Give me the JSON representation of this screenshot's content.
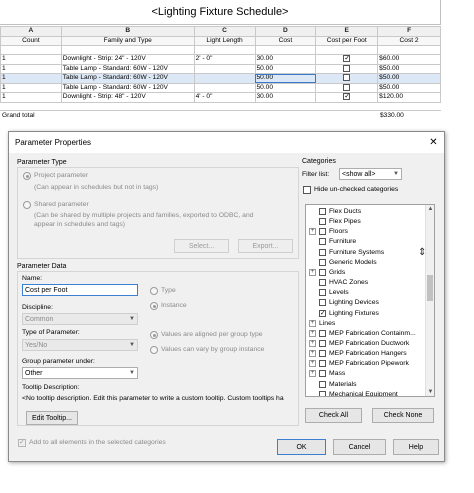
{
  "schedule": {
    "title": "<Lighting Fixture Schedule>",
    "letters": [
      "A",
      "B",
      "C",
      "D",
      "E",
      "F"
    ],
    "headers": [
      "Count",
      "Family and Type",
      "Light Length",
      "Cost",
      "Cost per Foot",
      "Cost 2"
    ],
    "rows": [
      {
        "count": "1",
        "family": "Downlight - Strip: 24\" - 120V",
        "length": "2' - 0\"",
        "cost": "30.00",
        "cpf": true,
        "cost2": "$60.00"
      },
      {
        "count": "1",
        "family": "Table Lamp - Standard: 60W - 120V",
        "length": "",
        "cost": "50.00",
        "cpf": false,
        "cost2": "$50.00"
      },
      {
        "count": "1",
        "family": "Table Lamp - Standard: 60W - 120V",
        "length": "",
        "cost": "50.00",
        "cpf": false,
        "cost2": "$50.00"
      },
      {
        "count": "1",
        "family": "Table Lamp - Standard: 60W - 120V",
        "length": "",
        "cost": "50.00",
        "cpf": false,
        "cost2": "$50.00"
      },
      {
        "count": "1",
        "family": "Downlight - Strip: 48\" - 120V",
        "length": "4' - 0\"",
        "cost": "30.00",
        "cpf": true,
        "cost2": "$120.00"
      }
    ],
    "grand_total_label": "Grand total",
    "grand_total_value": "$330.00"
  },
  "dialog": {
    "title": "Parameter Properties",
    "parameter_type": {
      "heading": "Parameter Type",
      "project_label": "Project parameter",
      "project_desc": "(Can appear in schedules but not in tags)",
      "shared_label": "Shared parameter",
      "shared_desc_1": "(Can be shared by multiple projects and families, exported to ODBC, and",
      "shared_desc_2": "appear in schedules and tags)",
      "select_button": "Select...",
      "export_button": "Export..."
    },
    "parameter_data": {
      "heading": "Parameter Data",
      "name_label": "Name:",
      "name_value": "Cost per Foot",
      "type_label": "Type",
      "instance_label": "Instance",
      "discipline_label": "Discipline:",
      "discipline_value": "Common",
      "type_of_param_label": "Type of Parameter:",
      "type_of_param_value": "Yes/No",
      "aligned_label": "Values are aligned per group type",
      "vary_label": "Values can vary by group instance",
      "group_under_label": "Group parameter under:",
      "group_under_value": "Other",
      "tooltip_label": "Tooltip Description:",
      "tooltip_text": "<No tooltip description. Edit this parameter to write a custom tooltip. Custom tooltips ha",
      "edit_tooltip_button": "Edit Tooltip..."
    },
    "categories": {
      "heading": "Categories",
      "filter_label": "Filter list:",
      "filter_value": "<show all>",
      "hide_unchecked_label": "Hide un-checked categories",
      "items": [
        {
          "name": "Flex Ducts",
          "checked": false,
          "expandable": false,
          "top": false
        },
        {
          "name": "Flex Pipes",
          "checked": false,
          "expandable": false,
          "top": false
        },
        {
          "name": "Floors",
          "checked": false,
          "expandable": true,
          "top": false
        },
        {
          "name": "Furniture",
          "checked": false,
          "expandable": false,
          "top": false
        },
        {
          "name": "Furniture Systems",
          "checked": false,
          "expandable": false,
          "top": false
        },
        {
          "name": "Generic Models",
          "checked": false,
          "expandable": false,
          "top": false
        },
        {
          "name": "Grids",
          "checked": false,
          "expandable": true,
          "top": false
        },
        {
          "name": "HVAC Zones",
          "checked": false,
          "expandable": false,
          "top": false
        },
        {
          "name": "Levels",
          "checked": false,
          "expandable": false,
          "top": false
        },
        {
          "name": "Lighting Devices",
          "checked": false,
          "expandable": false,
          "top": false
        },
        {
          "name": "Lighting Fixtures",
          "checked": true,
          "expandable": false,
          "top": false
        },
        {
          "name": "Lines",
          "checked": false,
          "expandable": true,
          "top": true
        },
        {
          "name": "MEP Fabrication Containm...",
          "checked": false,
          "expandable": true,
          "top": false
        },
        {
          "name": "MEP Fabrication Ductwork",
          "checked": false,
          "expandable": true,
          "top": false
        },
        {
          "name": "MEP Fabrication Hangers",
          "checked": false,
          "expandable": true,
          "top": false
        },
        {
          "name": "MEP Fabrication Pipework",
          "checked": false,
          "expandable": true,
          "top": false
        },
        {
          "name": "Mass",
          "checked": false,
          "expandable": true,
          "top": false
        },
        {
          "name": "Materials",
          "checked": false,
          "expandable": false,
          "top": false
        },
        {
          "name": "Mechanical Equipment",
          "checked": false,
          "expandable": false,
          "top": false
        }
      ],
      "check_all_button": "Check All",
      "check_none_button": "Check None"
    },
    "add_all_label": "Add to all elements in the selected categories",
    "ok_button": "OK",
    "cancel_button": "Cancel",
    "help_button": "Help"
  }
}
